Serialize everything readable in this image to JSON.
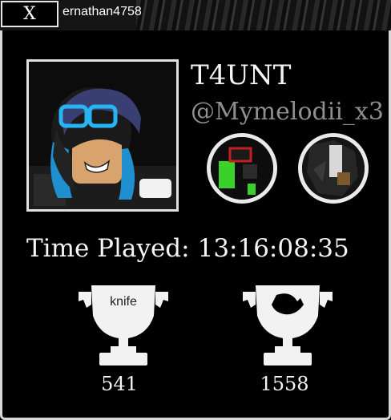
{
  "top_bar": {
    "close_label": "X",
    "username": "ernathan4758"
  },
  "profile": {
    "display_name": "T4UNT",
    "handle": "@Mymelodii_x3"
  },
  "stats": {
    "time_label": "Time Played:",
    "time_value": "13:16:08:35"
  },
  "trophies": [
    {
      "label": "knife",
      "count": "541",
      "icon": "trophy-knife-icon"
    },
    {
      "label": "",
      "count": "1558",
      "icon": "trophy-gun-icon"
    }
  ],
  "colors": {
    "background": "#000000",
    "text": "#f5f5f5",
    "handle": "#8f8f8f",
    "frame": "#e0e0e0"
  }
}
